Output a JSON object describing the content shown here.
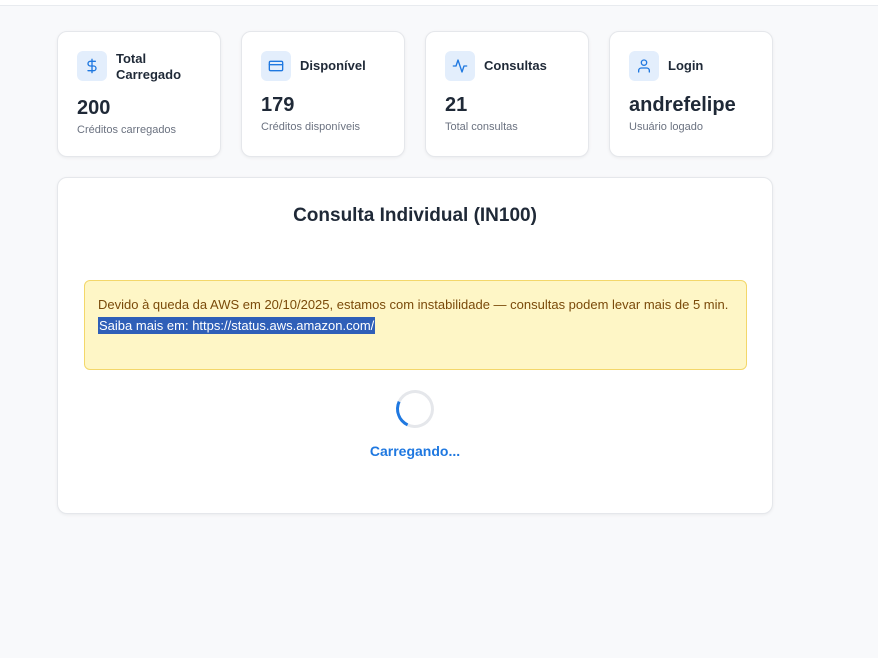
{
  "cards": [
    {
      "icon": "dollar-icon",
      "title_line1": "Total",
      "title_line2": "Carregado",
      "value": "200",
      "sub": "Créditos carregados"
    },
    {
      "icon": "credit-card-icon",
      "title": "Disponível",
      "value": "179",
      "sub": "Créditos disponíveis"
    },
    {
      "icon": "activity-icon",
      "title": "Consultas",
      "value": "21",
      "sub": "Total consultas"
    },
    {
      "icon": "user-icon",
      "title": "Login",
      "value": "andrefelipe",
      "sub": "Usuário logado"
    }
  ],
  "panel": {
    "title": "Consulta Individual (IN100)",
    "warning_text": "Devido à queda da AWS em 20/10/2025, estamos com instabilidade — consultas podem levar mais de 5 min.",
    "warning_link": "Saiba mais em: https://status.aws.amazon.com/",
    "loading": "Carregando..."
  },
  "colors": {
    "accent": "#1f78e0",
    "icon_bg": "#e3eefc",
    "warning_bg": "#fef6c6",
    "warning_text": "#7a4a0a",
    "selection": "#2f5fb8"
  }
}
